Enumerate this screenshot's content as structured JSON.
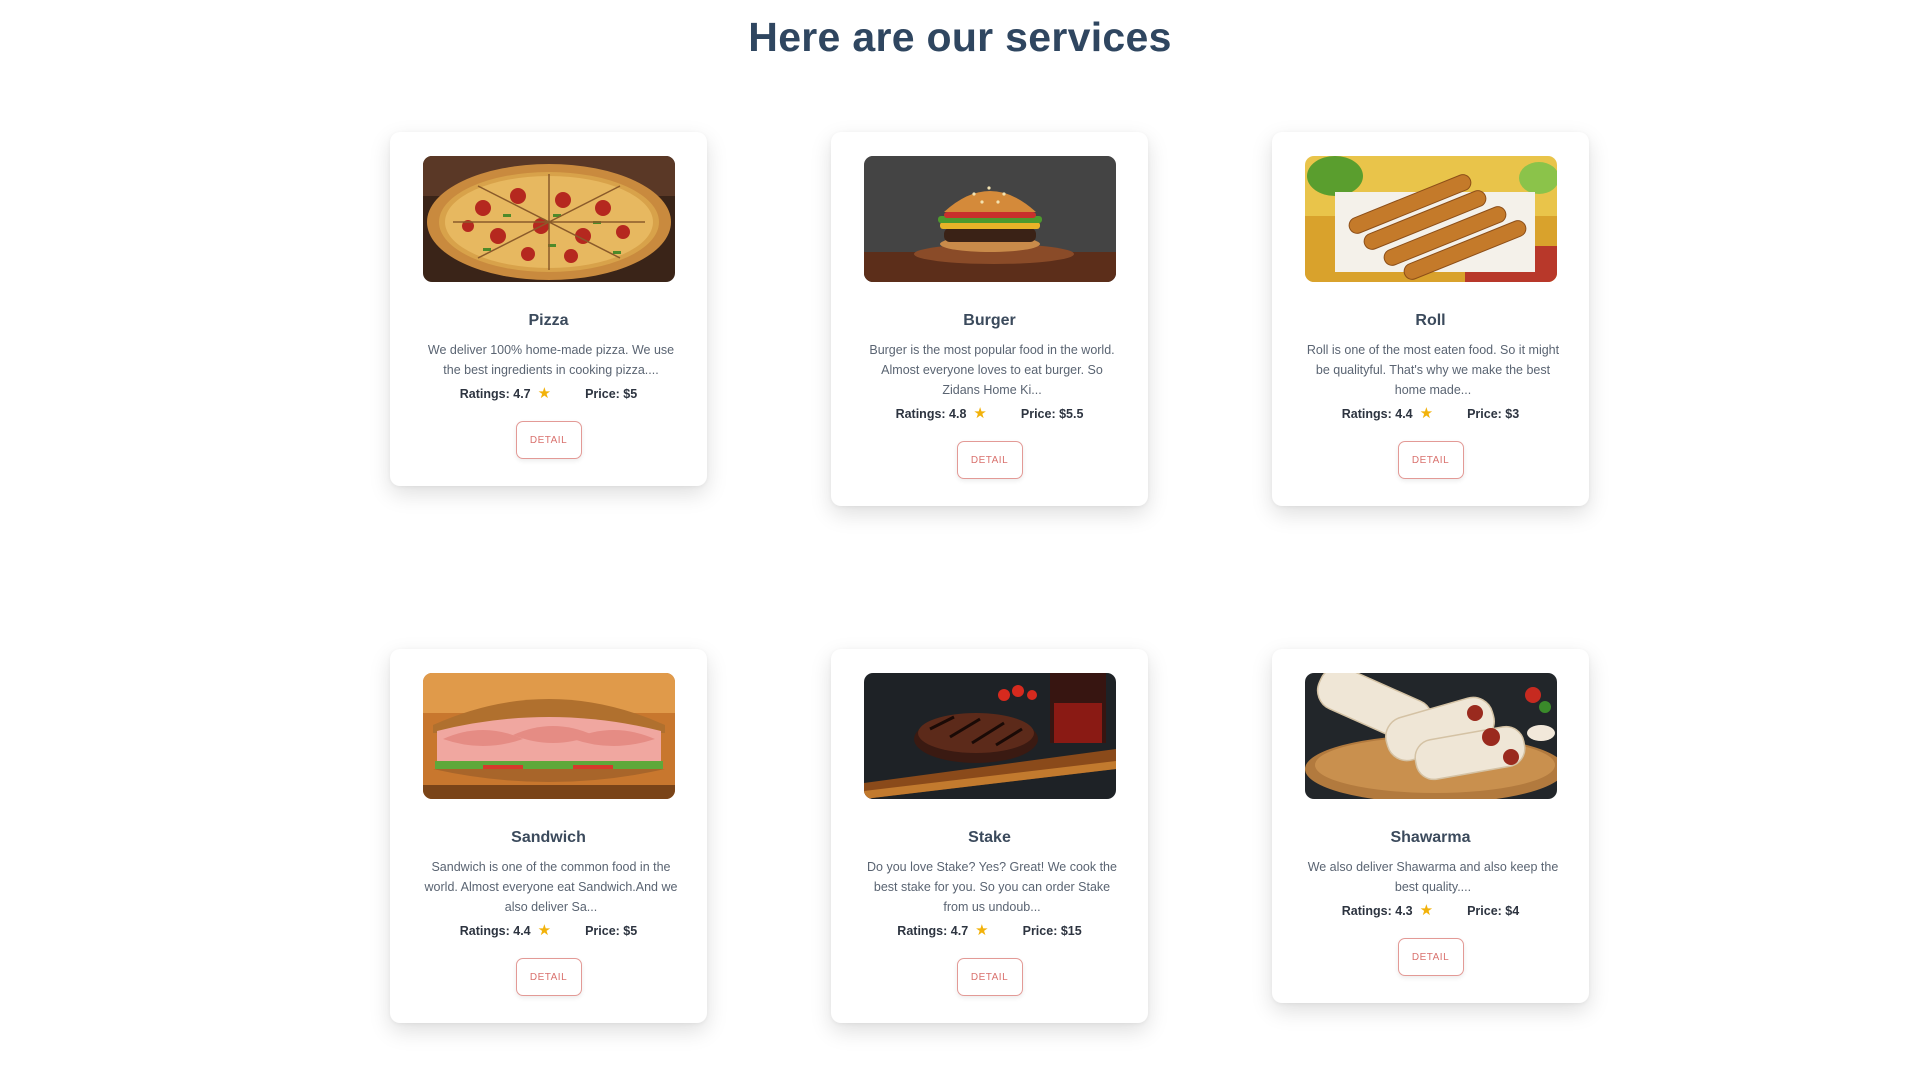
{
  "page": {
    "title": "Here are our services"
  },
  "cards": [
    {
      "name": "Pizza",
      "description": "We deliver 100% home-made pizza. We use the best ingredients in cooking pizza....",
      "ratings_label": "Ratings: 4.7",
      "price_label": "Price: $5",
      "button": "DETAIL",
      "image_icon": "pizza-image"
    },
    {
      "name": "Burger",
      "description": "Burger is the most popular food in the world. Almost everyone loves to eat burger. So Zidans Home Ki...",
      "ratings_label": "Ratings: 4.8",
      "price_label": "Price: $5.5",
      "button": "DETAIL",
      "image_icon": "burger-image"
    },
    {
      "name": "Roll",
      "description": "Roll is one of the most eaten food. So it might be qualityful. That's why we make the best home made...",
      "ratings_label": "Ratings: 4.4",
      "price_label": "Price: $3",
      "button": "DETAIL",
      "image_icon": "roll-image"
    },
    {
      "name": "Sandwich",
      "description": "Sandwich is one of the common food in the world. Almost everyone eat Sandwich.And we also deliver Sa...",
      "ratings_label": "Ratings: 4.4",
      "price_label": "Price: $5",
      "button": "DETAIL",
      "image_icon": "sandwich-image"
    },
    {
      "name": "Stake",
      "description": "Do you love Stake? Yes? Great! We cook the best stake for you. So you can order Stake from us undoub...",
      "ratings_label": "Ratings: 4.7",
      "price_label": "Price: $15",
      "button": "DETAIL",
      "image_icon": "steak-image"
    },
    {
      "name": "Shawarma",
      "description": "We also deliver Shawarma and also keep the best quality....",
      "ratings_label": "Ratings: 4.3",
      "price_label": "Price: $4",
      "button": "DETAIL",
      "image_icon": "shawarma-image"
    }
  ],
  "colors": {
    "title": "#2f4660",
    "star": "#f2b20a",
    "button_border": "#e39a96",
    "button_text": "#d9716d"
  }
}
